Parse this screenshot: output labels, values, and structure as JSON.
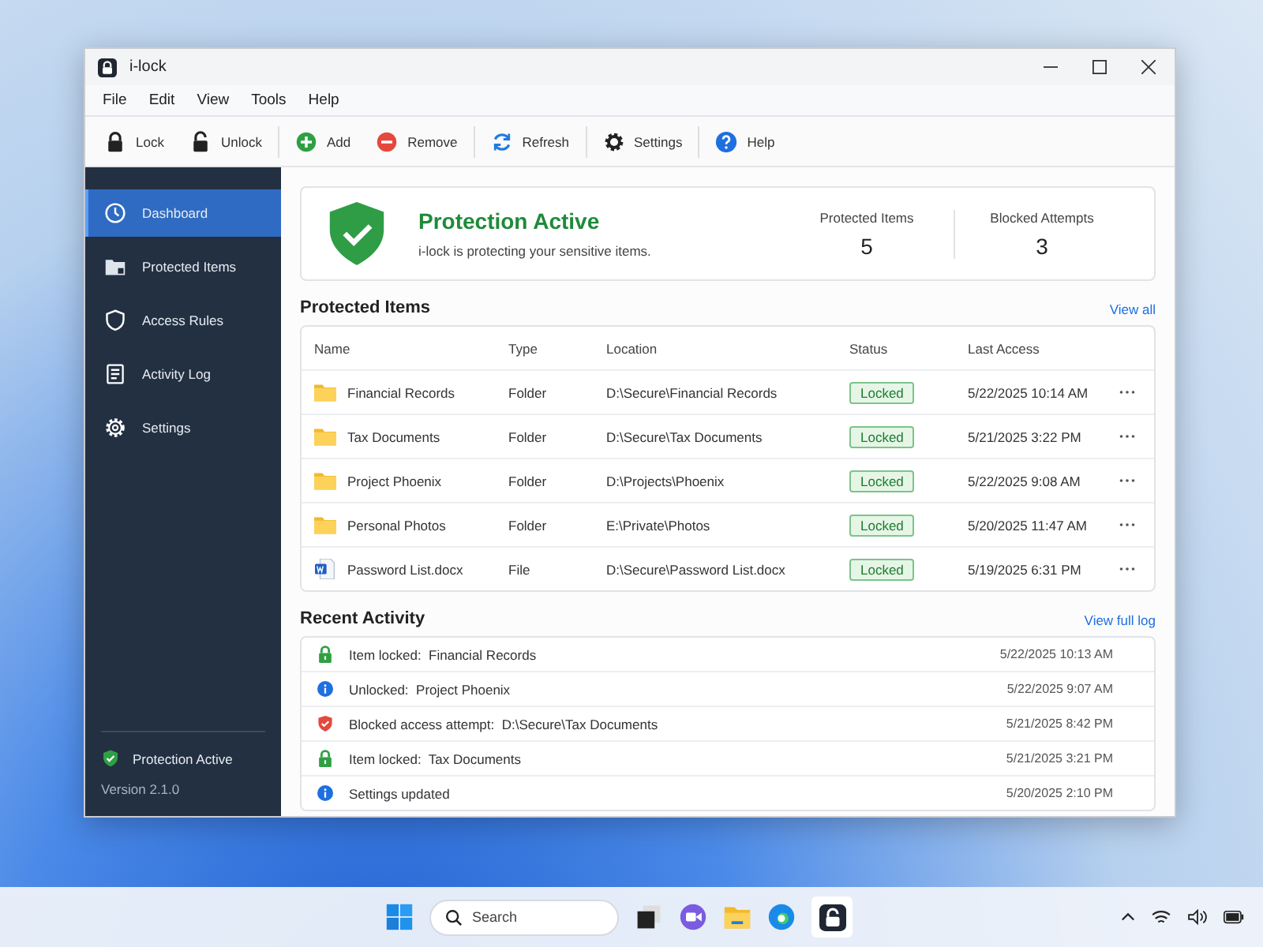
{
  "window": {
    "title": "i-lock"
  },
  "menu": [
    "File",
    "Edit",
    "View",
    "Tools",
    "Help"
  ],
  "toolbar": [
    {
      "label": "Lock",
      "kind": "lock"
    },
    {
      "label": "Unlock",
      "kind": "unlock"
    },
    {
      "label": "Add",
      "kind": "add"
    },
    {
      "label": "Remove",
      "kind": "remove"
    },
    {
      "label": "Refresh",
      "kind": "refresh"
    },
    {
      "label": "Settings",
      "kind": "settings"
    },
    {
      "label": "Help",
      "kind": "help"
    }
  ],
  "sidebar": {
    "items": [
      {
        "label": "Dashboard",
        "kind": "dashboard",
        "selected": true
      },
      {
        "label": "Protected Items",
        "kind": "items",
        "selected": false
      },
      {
        "label": "Access Rules",
        "kind": "rules",
        "selected": false
      },
      {
        "label": "Activity Log",
        "kind": "log",
        "selected": false
      },
      {
        "label": "Settings",
        "kind": "settings",
        "selected": false
      }
    ],
    "status": "Protection Active",
    "version": "Version 2.1.0"
  },
  "summary": {
    "title": "Protection Active",
    "subtitle": "i-lock is protecting your sensitive items.",
    "stats": [
      {
        "label": "Protected Items",
        "value": "5"
      },
      {
        "label": "Blocked Attempts",
        "value": "3"
      }
    ]
  },
  "protected_items": {
    "title": "Protected Items",
    "link": "View all",
    "columns": [
      "Name",
      "Type",
      "Location",
      "Status",
      "Last Access"
    ],
    "rows": [
      {
        "kind": "folder",
        "name": "Financial Records",
        "type": "Folder",
        "location": "D:\\Secure\\Financial Records",
        "status": "Locked",
        "last_access": "5/22/2025 10:14 AM"
      },
      {
        "kind": "folder",
        "name": "Tax Documents",
        "type": "Folder",
        "location": "D:\\Secure\\Tax Documents",
        "status": "Locked",
        "last_access": "5/21/2025 3:22 PM"
      },
      {
        "kind": "folder",
        "name": "Project Phoenix",
        "type": "Folder",
        "location": "D:\\Projects\\Phoenix",
        "status": "Locked",
        "last_access": "5/22/2025 9:08 AM"
      },
      {
        "kind": "folder",
        "name": "Personal Photos",
        "type": "Folder",
        "location": "E:\\Private\\Photos",
        "status": "Locked",
        "last_access": "5/20/2025 11:47 AM"
      },
      {
        "kind": "document",
        "name": "Password List.docx",
        "type": "File",
        "location": "D:\\Secure\\Password List.docx",
        "status": "Locked",
        "last_access": "5/19/2025 6:31 PM"
      }
    ]
  },
  "recent_activity": {
    "title": "Recent Activity",
    "link": "View full log",
    "rows": [
      {
        "kind": "lock",
        "text": "Item locked:  Financial Records",
        "time": "5/22/2025 10:13 AM"
      },
      {
        "kind": "info",
        "text": "Unlocked:  Project Phoenix",
        "time": "5/22/2025 9:07 AM"
      },
      {
        "kind": "blocked",
        "text": "Blocked access attempt:  D:\\Secure\\Tax Documents",
        "time": "5/21/2025 8:42 PM"
      },
      {
        "kind": "lock",
        "text": "Item locked:  Tax Documents",
        "time": "5/21/2025 3:21 PM"
      },
      {
        "kind": "info",
        "text": "Settings updated",
        "time": "5/20/2025 2:10 PM"
      }
    ]
  },
  "taskbar": {
    "search_placeholder": "Search"
  }
}
